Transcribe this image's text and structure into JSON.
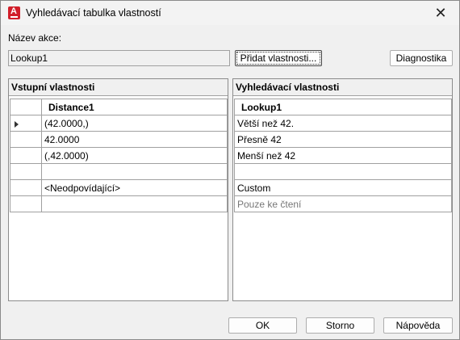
{
  "window": {
    "title": "Vyhledávací tabulka vlastností",
    "app_icon_letter": "A",
    "close_glyph": "✕"
  },
  "form": {
    "action_label": "Název akce:",
    "action_value": "Lookup1",
    "add_properties_button": "Přidat vlastnosti...",
    "diagnostics_button": "Diagnostika"
  },
  "input_panel": {
    "title": "Vstupní vlastnosti",
    "column_header": "Distance1",
    "rows": [
      "(42.0000,)",
      "42.0000",
      "(,42.0000)",
      "",
      "<Neodpovídající>",
      ""
    ]
  },
  "lookup_panel": {
    "title": "Vyhledávací vlastnosti",
    "column_header": "Lookup1",
    "rows": [
      "Větší než 42.",
      "Přesně 42",
      "Menší než 42",
      "",
      "Custom",
      "Pouze ke čtení"
    ]
  },
  "footer": {
    "ok_button": "OK",
    "cancel_button": "Storno",
    "help_button": "Nápověda"
  }
}
